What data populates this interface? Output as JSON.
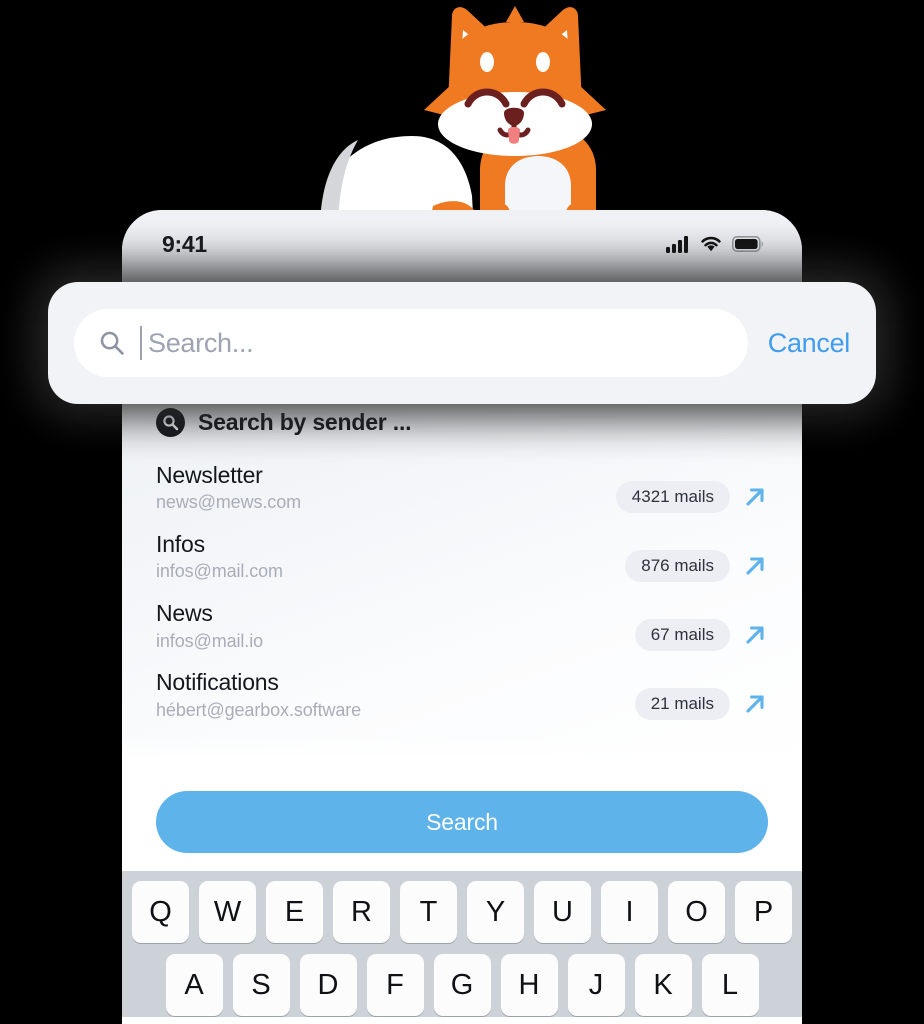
{
  "statusbar": {
    "time": "9:41",
    "icons": [
      "cellular-signal-icon",
      "wifi-icon",
      "battery-icon"
    ]
  },
  "search_card": {
    "search_icon": "search-icon",
    "placeholder": "Search...",
    "value": "",
    "cancel_label": "Cancel"
  },
  "section": {
    "icon": "sender-search-icon",
    "title": "Search by sender ..."
  },
  "senders": [
    {
      "name": "Newsletter",
      "email": "news@mews.com",
      "count": "4321 mails",
      "action_icon": "arrow-up-right-icon"
    },
    {
      "name": "Infos",
      "email": "infos@mail.com",
      "count": "876 mails",
      "action_icon": "arrow-up-right-icon"
    },
    {
      "name": "News",
      "email": "infos@mail.io",
      "count": "67 mails",
      "action_icon": "arrow-up-right-icon"
    },
    {
      "name": "Notifications",
      "email": "hébert@gearbox.software",
      "count": "21 mails",
      "action_icon": "arrow-up-right-icon"
    }
  ],
  "cta": {
    "label": "Search"
  },
  "keyboard": {
    "row1": [
      "Q",
      "W",
      "E",
      "R",
      "T",
      "Y",
      "U",
      "I",
      "O",
      "P"
    ],
    "row2": [
      "A",
      "S",
      "D",
      "F",
      "G",
      "H",
      "J",
      "K",
      "L"
    ]
  },
  "mascot": {
    "name": "fox-mascot",
    "fur_color": "#ef7a22",
    "belly_color": "#ffffff",
    "nose_color": "#6b1f1f",
    "tongue_color": "#f08080"
  },
  "colors": {
    "accent_blue": "#5eb3ea",
    "link_blue": "#3f9cf0",
    "badge_bg": "#eceef3",
    "background": "#000000"
  }
}
